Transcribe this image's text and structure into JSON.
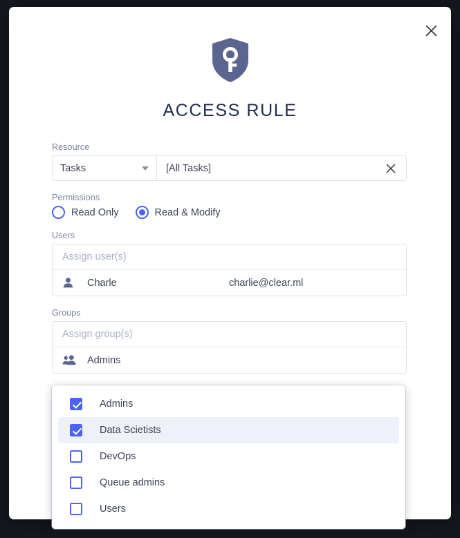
{
  "dialog": {
    "title": "ACCESS RULE",
    "close_label": "Close",
    "shield_icon": "shield-key-icon",
    "close_icon": "close-icon"
  },
  "resource": {
    "label": "Resource",
    "select_value": "Tasks",
    "select_icon": "chevron-down-icon",
    "filter_value": "[All Tasks]",
    "clear_icon": "close-icon"
  },
  "permissions": {
    "label": "Permissions",
    "options": [
      {
        "label": "Read Only",
        "selected": false
      },
      {
        "label": "Read & Modify",
        "selected": true
      }
    ]
  },
  "users": {
    "label": "Users",
    "placeholder": "Assign user(s)",
    "rows": [
      {
        "icon": "person-icon",
        "name": "Charle",
        "email": "charlie@clear.ml"
      }
    ]
  },
  "groups": {
    "label": "Groups",
    "placeholder": "Assign group(s)",
    "rows": [
      {
        "icon": "people-icon",
        "name": "Admins"
      }
    ]
  },
  "groups_dropdown": {
    "items": [
      {
        "label": "Admins",
        "checked": true,
        "highlighted": false
      },
      {
        "label": "Data Scietists",
        "checked": true,
        "highlighted": true
      },
      {
        "label": "DevOps",
        "checked": false,
        "highlighted": false
      },
      {
        "label": "Queue admins",
        "checked": false,
        "highlighted": false
      },
      {
        "label": "Users",
        "checked": false,
        "highlighted": false
      }
    ]
  },
  "colors": {
    "accent": "#4a63f0",
    "shield": "#5a6590",
    "backdrop": "#16181f",
    "title": "#212b4a",
    "highlight_row": "#eef1f9"
  }
}
